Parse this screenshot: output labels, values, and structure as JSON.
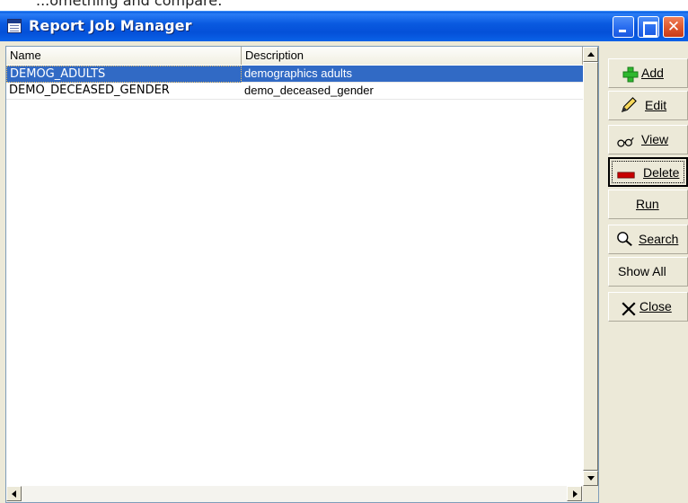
{
  "window": {
    "title": "Report Job Manager"
  },
  "background_text": "...omething and compare:",
  "list": {
    "columns": [
      "Name",
      "Description"
    ],
    "rows": [
      {
        "name": "DEMOG_ADULTS",
        "description": "demographics adults",
        "selected": true
      },
      {
        "name": "DEMO_DECEASED_GENDER",
        "description": "demo_deceased_gender",
        "selected": false
      }
    ]
  },
  "buttons": {
    "add": "Add",
    "edit": "Edit",
    "view": "View",
    "delete": "Delete",
    "run": "Run",
    "search": "Search",
    "show_all": "Show All",
    "close": "Close"
  },
  "icons": {
    "app": "table-icon",
    "add": "green-plus-icon",
    "edit": "pencil-icon",
    "view": "glasses-icon",
    "delete": "red-minus-icon",
    "search": "magnifier-icon",
    "close": "x-icon"
  },
  "colors": {
    "titlebar": "#0a5ae0",
    "selection": "#316ac5",
    "add_icon": "#2eb82e",
    "delete_icon": "#c80000"
  }
}
